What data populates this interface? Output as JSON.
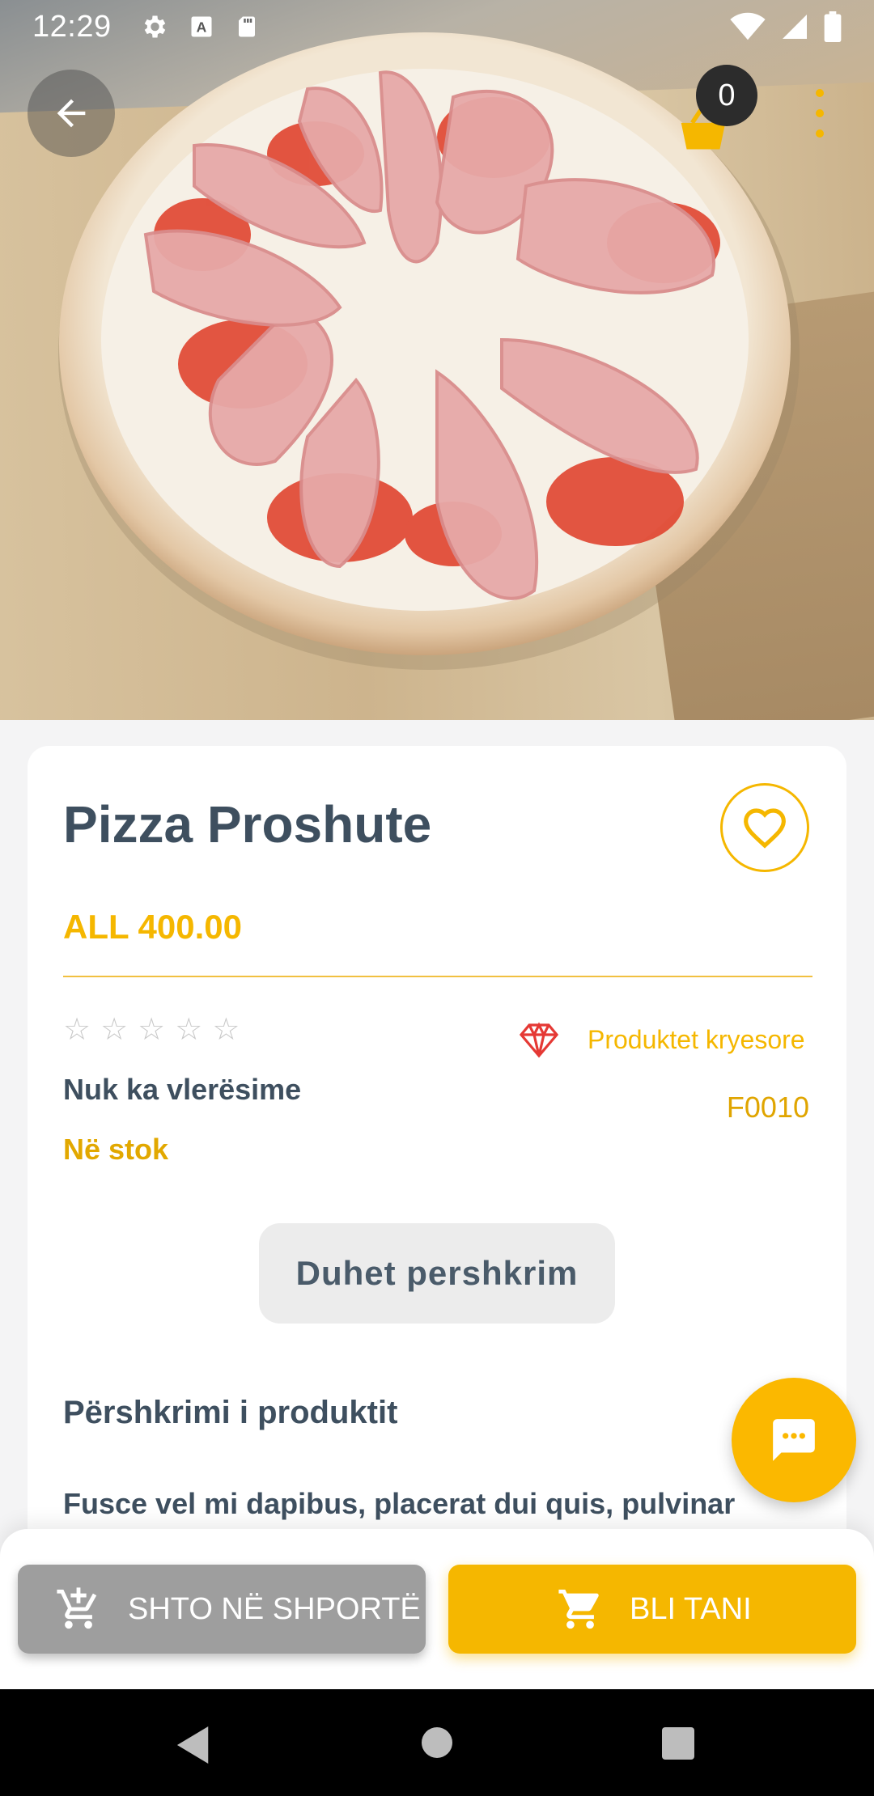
{
  "status_bar": {
    "time": "12:29",
    "icons": [
      "settings-icon",
      "a-icon",
      "sd-card-icon",
      "wifi-icon",
      "signal-icon",
      "battery-icon"
    ]
  },
  "header": {
    "cart_count": "0",
    "icons": [
      "back-arrow-icon",
      "basket-icon",
      "more-vert-icon"
    ]
  },
  "product": {
    "name": "Pizza Proshute",
    "price": "ALL 400.00",
    "rating_stars": 0,
    "rating_max": 5,
    "no_ratings_text": "Nuk ka vlerësime",
    "stock_status": "Në stok",
    "featured_label": "Produktet kryesore",
    "sku": "F0010",
    "description_button": "Duhet pershkrim",
    "description_title": "Përshkrimi i produktit",
    "description_text": "Fusce vel mi dapibus, placerat dui quis, pulvinar tortor ac arcu. Curabitur consectetur justo vel velit."
  },
  "actions": {
    "add_to_cart": "SHTO NË SHPORTË",
    "buy_now": "BLI TANI"
  },
  "colors": {
    "accent": "#f5b700",
    "text_dark": "#3e4f5f",
    "cart_button": "#9e9e9e",
    "featured_icon": "#e53935"
  }
}
